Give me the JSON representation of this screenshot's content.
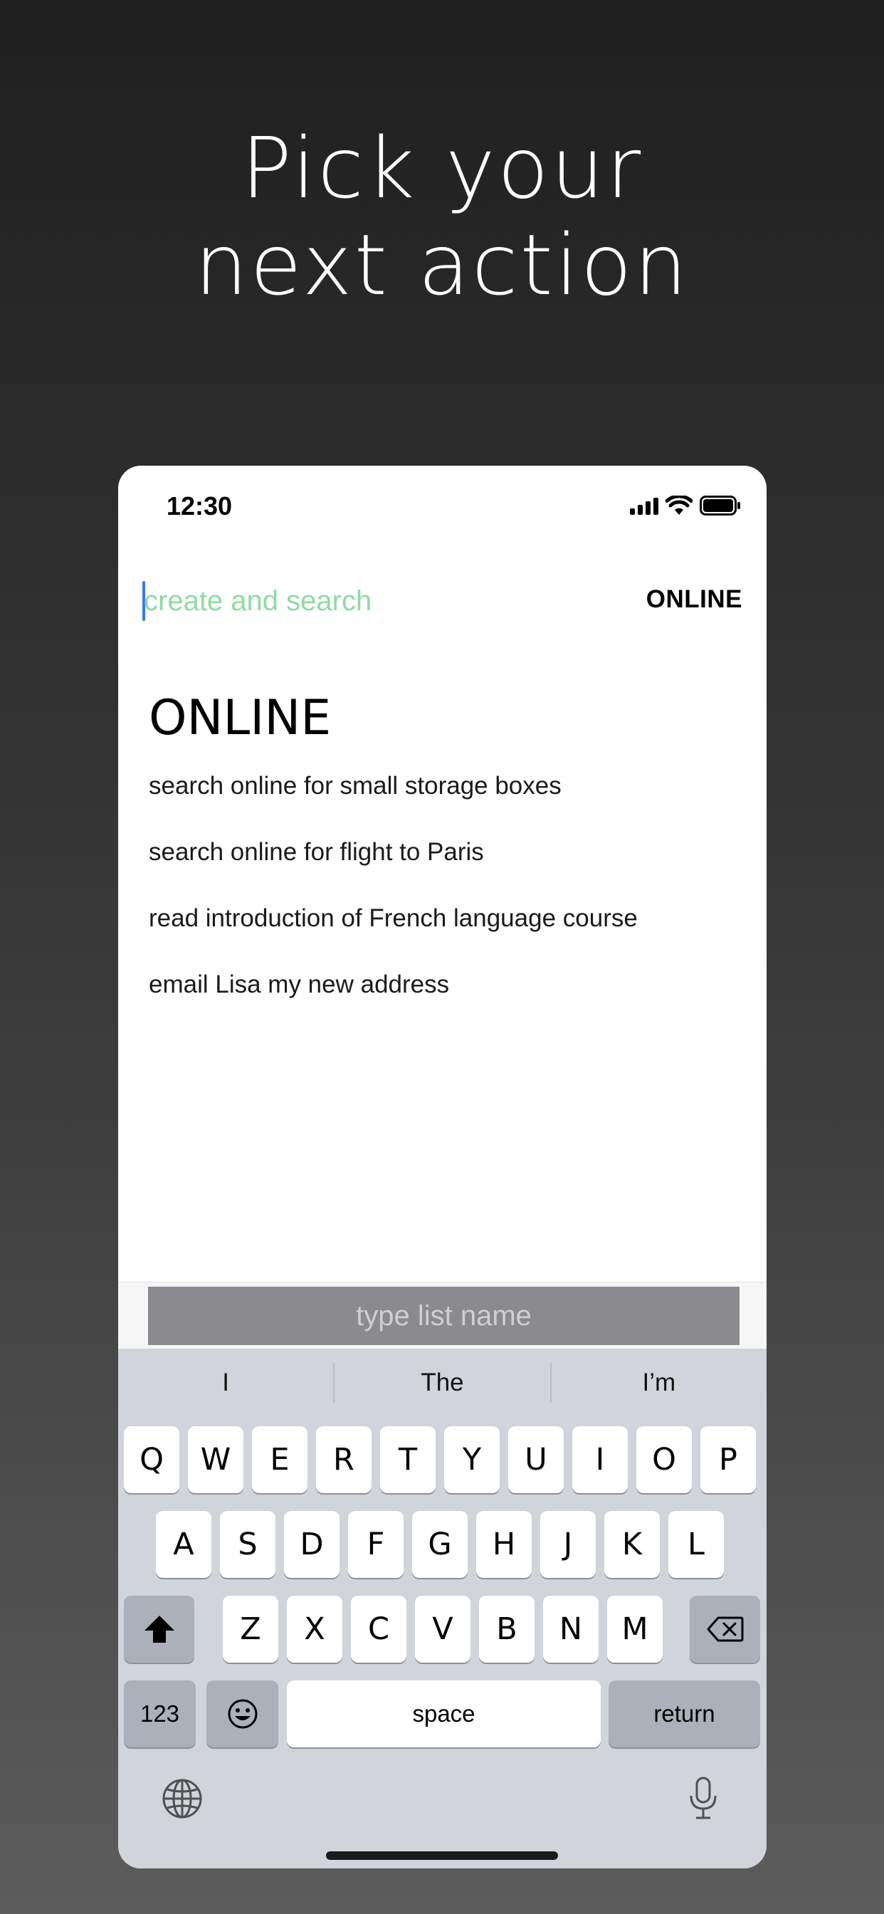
{
  "headline": {
    "line1": "Pick your",
    "line2": "next action"
  },
  "status_bar": {
    "time": "12:30"
  },
  "search": {
    "placeholder": "create and search",
    "mode_label": "ONLINE"
  },
  "section": {
    "title": "ONLINE",
    "items": [
      "search online for small storage boxes",
      "search online for flight to Paris",
      "read introduction of French language course",
      "email Lisa my new address"
    ]
  },
  "list_name": {
    "placeholder": "type list name"
  },
  "keyboard": {
    "predictions": [
      "I",
      "The",
      "I’m"
    ],
    "row1": [
      "Q",
      "W",
      "E",
      "R",
      "T",
      "Y",
      "U",
      "I",
      "O",
      "P"
    ],
    "row2": [
      "A",
      "S",
      "D",
      "F",
      "G",
      "H",
      "J",
      "K",
      "L"
    ],
    "row3": [
      "Z",
      "X",
      "C",
      "V",
      "B",
      "N",
      "M"
    ],
    "numbers_label": "123",
    "space_label": "space",
    "return_label": "return"
  },
  "colors": {
    "accent_placeholder": "#8fdba4",
    "caret": "#3478f6",
    "list_bar": "#8a8a8f",
    "keyboard_bg": "#d1d4da"
  },
  "icons": [
    "signal-icon",
    "wifi-icon",
    "battery-icon",
    "shift-icon",
    "backspace-icon",
    "emoji-icon",
    "globe-icon",
    "microphone-icon"
  ]
}
